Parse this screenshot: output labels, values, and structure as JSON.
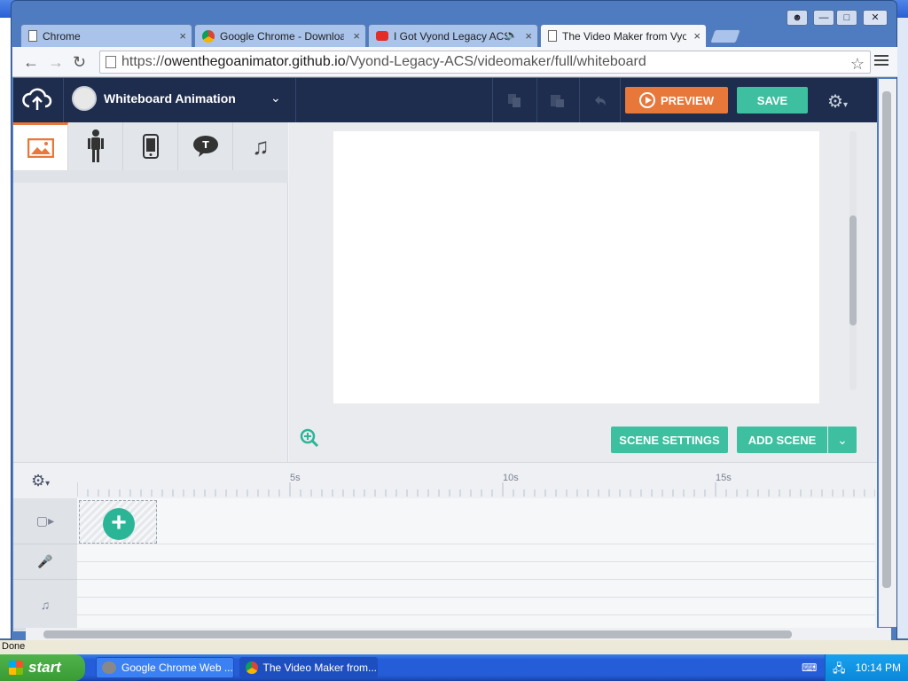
{
  "background_window": {
    "title": "Google Chrome Web Browser"
  },
  "browser": {
    "tabs": [
      {
        "label": "Chrome",
        "icon": "page-icon",
        "close": "×"
      },
      {
        "label": "Google Chrome - Download t",
        "icon": "chrome-icon",
        "close": "×"
      },
      {
        "label": "I Got Vyond Legacy ACS",
        "icon": "youtube-icon",
        "close": "×"
      },
      {
        "label": "The Video Maker from Vyond",
        "icon": "page-icon",
        "close": "×"
      }
    ],
    "url_prefix": "https://",
    "url_domain": "owenthegoanimator.github.io",
    "url_path": "/Vyond-Legacy-ACS/videomaker/full/whiteboard",
    "window_buttons": [
      "user",
      "minimize",
      "maximize",
      "close"
    ]
  },
  "app": {
    "video_title": "Whiteboard Animation",
    "preview_label": "PREVIEW",
    "save_label": "SAVE",
    "asset_tabs": [
      "image",
      "character",
      "prop",
      "text",
      "music"
    ],
    "active_asset_tab": "image",
    "stage": {
      "scene_settings_label": "SCENE SETTINGS",
      "add_scene_label": "ADD SCENE"
    },
    "timeline": {
      "ruler_labels": [
        "5s",
        "10s",
        "15s"
      ],
      "tracks": [
        "video",
        "voice",
        "music"
      ]
    },
    "colors": {
      "accent_orange": "#e8773a",
      "accent_teal": "#3dbfa0",
      "topbar": "#1e2d4d"
    }
  },
  "status": {
    "text": "Done"
  },
  "taskbar": {
    "start_label": "start",
    "items": [
      {
        "label": "Google Chrome Web ...",
        "icon": "raccoon-icon"
      },
      {
        "label": "The Video Maker from...",
        "icon": "chrome-icon"
      }
    ],
    "clock": "10:14 PM"
  }
}
